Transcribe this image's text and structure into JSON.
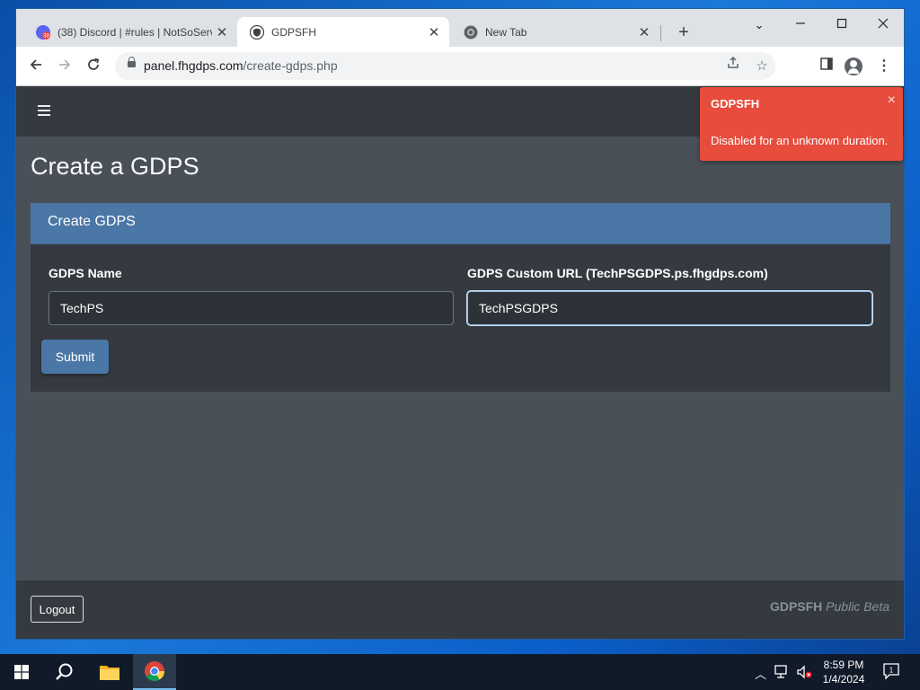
{
  "browser": {
    "tabs": [
      {
        "title": "(38) Discord | #rules | NotSoServ",
        "badge": "38",
        "active": false
      },
      {
        "title": "GDPSFH",
        "active": true
      },
      {
        "title": "New Tab",
        "active": false
      }
    ],
    "new_tab_symbol": "+",
    "url_host": "panel.fhgdps.com",
    "url_path": "/create-gdps.php"
  },
  "page": {
    "title": "Create a GDPS",
    "card_title": "Create GDPS",
    "form": {
      "name_label": "GDPS Name",
      "name_value": "TechPS",
      "url_label": "GDPS Custom URL (TechPSGDPS.ps.fhgdps.com)",
      "url_value": "TechPSGDPS",
      "submit_label": "Submit"
    },
    "footer": {
      "logout_label": "Logout",
      "brand_name": "GDPSFH",
      "brand_suffix": "Public Beta"
    }
  },
  "toast": {
    "title": "GDPSFH",
    "message": "Disabled for an unknown duration.",
    "close_symbol": "×",
    "color": "#e74c3c"
  },
  "taskbar": {
    "time": "8:59 PM",
    "date": "1/4/2024",
    "notification_count": "1"
  },
  "colors": {
    "navbar": "#343a40",
    "page_bg": "#4a5058",
    "primary": "#4a77a6"
  }
}
